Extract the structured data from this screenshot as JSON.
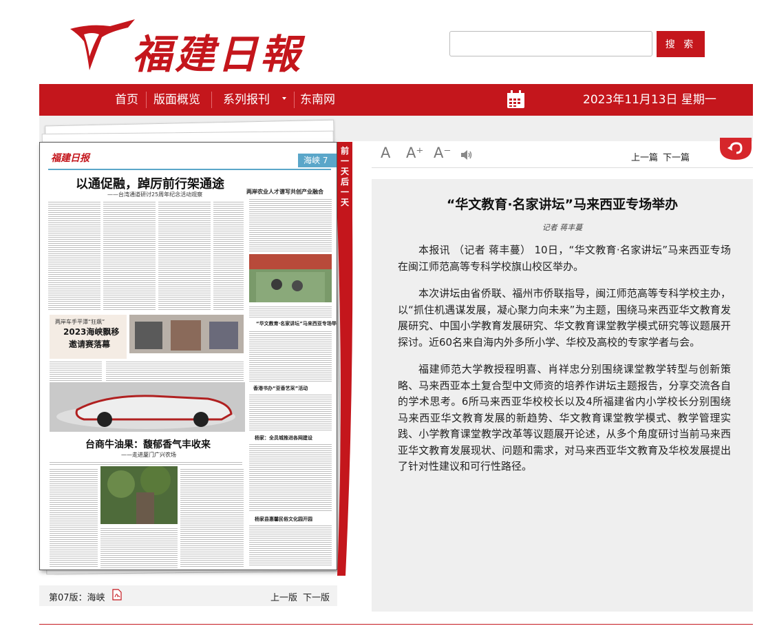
{
  "header": {
    "logo_text": "福建日報",
    "search_placeholder": "",
    "search_button": "搜 索"
  },
  "nav": {
    "items": [
      "首页",
      "版面概览",
      "系列报刊",
      "东南网"
    ],
    "date": "2023年11月13日 星期一"
  },
  "newspaper": {
    "masthead": "福建日报",
    "section_tag": "海峡 7",
    "headline": "以通促融，踔厉前行架通途",
    "subheadline": "——台湾通道研讨25周年纪念活动观察",
    "right_title_1": "两岸农业人才谱写共创产业融合",
    "right_title_2": "“华文教育·名家讲坛”马来西亚专场举办",
    "right_title_3": "香港书办“亚香艺采”活动",
    "right_title_4": "杨家：全员城推进各网建设",
    "right_title_5": "杨家县惠馨民俗文化园开园",
    "promo_a": "两岸车手平潭“狂飙”",
    "promo_b": "2023海峡飘移",
    "promo_c": "邀请赛落幕",
    "headline_2": "台商牛油果：馥郁香气丰收来",
    "subheadline_2": "——走进厦门广兴农场"
  },
  "day_tab": "前一天后一天",
  "page_footer": {
    "label": "第07版：海峡",
    "prev": "上一版",
    "next": "下一版"
  },
  "toolbar": {
    "font_normal": "A",
    "font_larger": "A⁺",
    "font_smaller": "A⁻",
    "prev_article": "上一篇",
    "next_article": "下一篇"
  },
  "article": {
    "title": "“华文教育·名家讲坛”马来西亚专场举办",
    "author": "记者  蒋丰蔓",
    "paragraphs": [
      "本报讯 （记者 蒋丰蔓） 10日，“华文教育·名家讲坛”马来西亚专场在闽江师范高等专科学校旗山校区举办。",
      "本次讲坛由省侨联、福州市侨联指导，闽江师范高等专科学校主办，以“抓住机遇谋发展，凝心聚力向未来”为主题，围绕马来西亚华文教育发展研究、中国小学教育发展研究、华文教育课堂教学模式研究等议题展开探讨。近60名来自海内外多所小学、华校及高校的专家学者与会。",
      "福建师范大学教授程明喜、肖祥忠分别围绕课堂教学转型与创新策略、马来西亚本土复合型中文师资的培养作讲坛主题报告，分享交流各自的学术思考。6所马来西亚华校校长以及4所福建省内小学校长分别围绕马来西亚华文教育发展的新趋势、华文教育课堂教学模式、教学管理实践、小学教育课堂教学改革等议题展开论述，从多个角度研讨当前马来西亚华文教育发展现状、问题和需求，对马来西亚华文教育及华校发展提出了针对性建议和可行性路径。"
    ]
  },
  "colors": {
    "brand_red": "#c4161c",
    "panel_gray": "#efefef"
  }
}
